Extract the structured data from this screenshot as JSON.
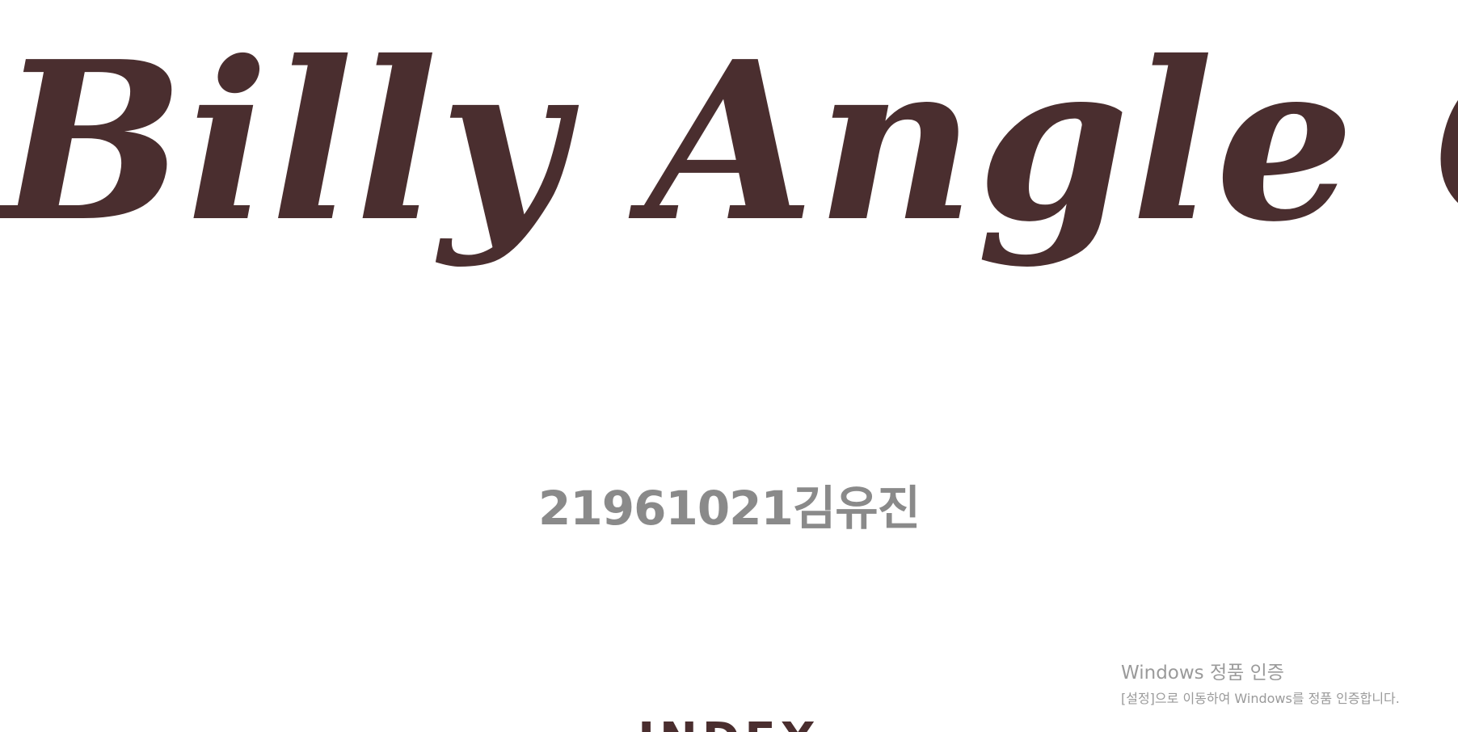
{
  "hero": {
    "title": "Billy Angle Cake",
    "student_id": "21961021김유진"
  },
  "index": {
    "heading": "INDEX"
  },
  "watermark": {
    "title": "Windows 정품 인증",
    "subtitle": "[설정]으로 이동하여 Windows를 정품 인증합니다."
  },
  "colors": {
    "brand": "#4a2e2f",
    "subtitle": "#8a8a8a",
    "watermark": "#9a9a9a",
    "background": "#ffffff"
  }
}
